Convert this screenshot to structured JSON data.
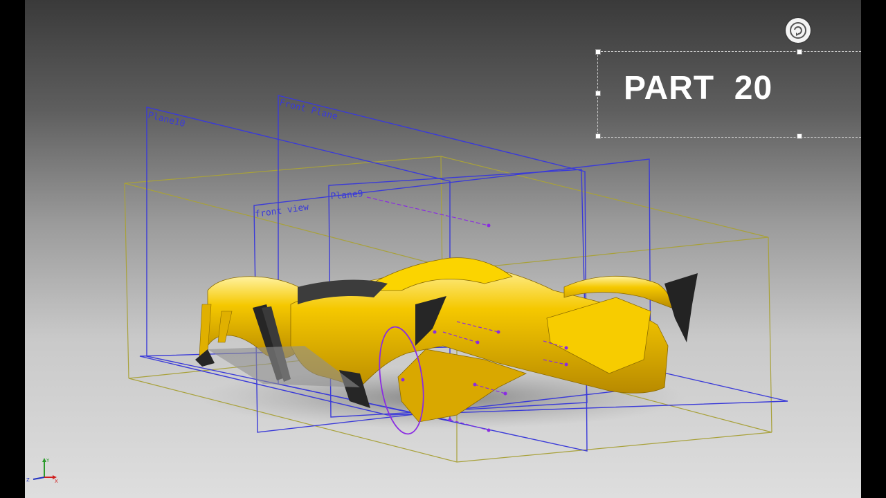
{
  "overlay": {
    "title": "PART  20"
  },
  "planes": {
    "plane10": "Plane10",
    "front_plane": "Front Plane",
    "plane9": "Plane9",
    "front_view": "front view"
  },
  "triad": {
    "y_axis": "Y",
    "z_axis": "Z",
    "x_axis": "X"
  },
  "colors": {
    "background_top": "#3a3a3a",
    "background_bottom": "#dedede",
    "plane_blue": "#3a3ad8",
    "bounding_box_olive": "#a8a13a",
    "car_yellow": "#f2c200",
    "sketch_purple": "#8a2be2"
  },
  "icons": {
    "rotate_button": "rotate-view-icon",
    "triad": "axis-triad-icon"
  }
}
